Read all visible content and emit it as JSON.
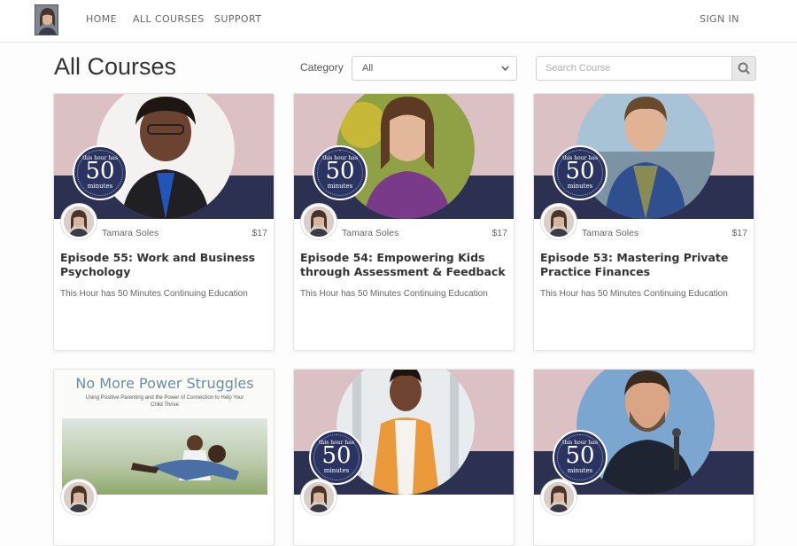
{
  "nav": {
    "home": "HOME",
    "courses": "ALL COURSES",
    "support": "SUPPORT",
    "signin": "SIGN IN"
  },
  "page": {
    "title": "All Courses",
    "category_label": "Category",
    "category_value": "All",
    "search_placeholder": "Search Course"
  },
  "colors": {
    "thumb_pink": "#dbc1c4",
    "thumb_navy": "#2c3152",
    "badge_navy": "#2b3460"
  },
  "badge": {
    "top": "this hour has",
    "num": "50",
    "bottom": "minutes"
  },
  "courses": [
    {
      "author": "Tamara Soles",
      "price": "$17",
      "title": "Episode 55: Work and Business Psychology",
      "subtitle": "This Hour has 50 Minutes Continuing Education"
    },
    {
      "author": "Tamara Soles",
      "price": "$17",
      "title": "Episode 54: Empowering Kids through Assessment & Feedback",
      "subtitle": "This Hour has 50 Minutes Continuing Education"
    },
    {
      "author": "Tamara Soles",
      "price": "$17",
      "title": "Episode 53: Mastering Private Practice Finances",
      "subtitle": "This Hour has 50 Minutes Continuing Education"
    },
    {
      "thumb_title": "No More Power Struggles",
      "thumb_subtitle": "Using Positive Parenting and the Power of Connection to Help Your Child Thrive"
    }
  ],
  "icons": {
    "search": "search-icon",
    "chevron": "chevron-down-icon"
  }
}
